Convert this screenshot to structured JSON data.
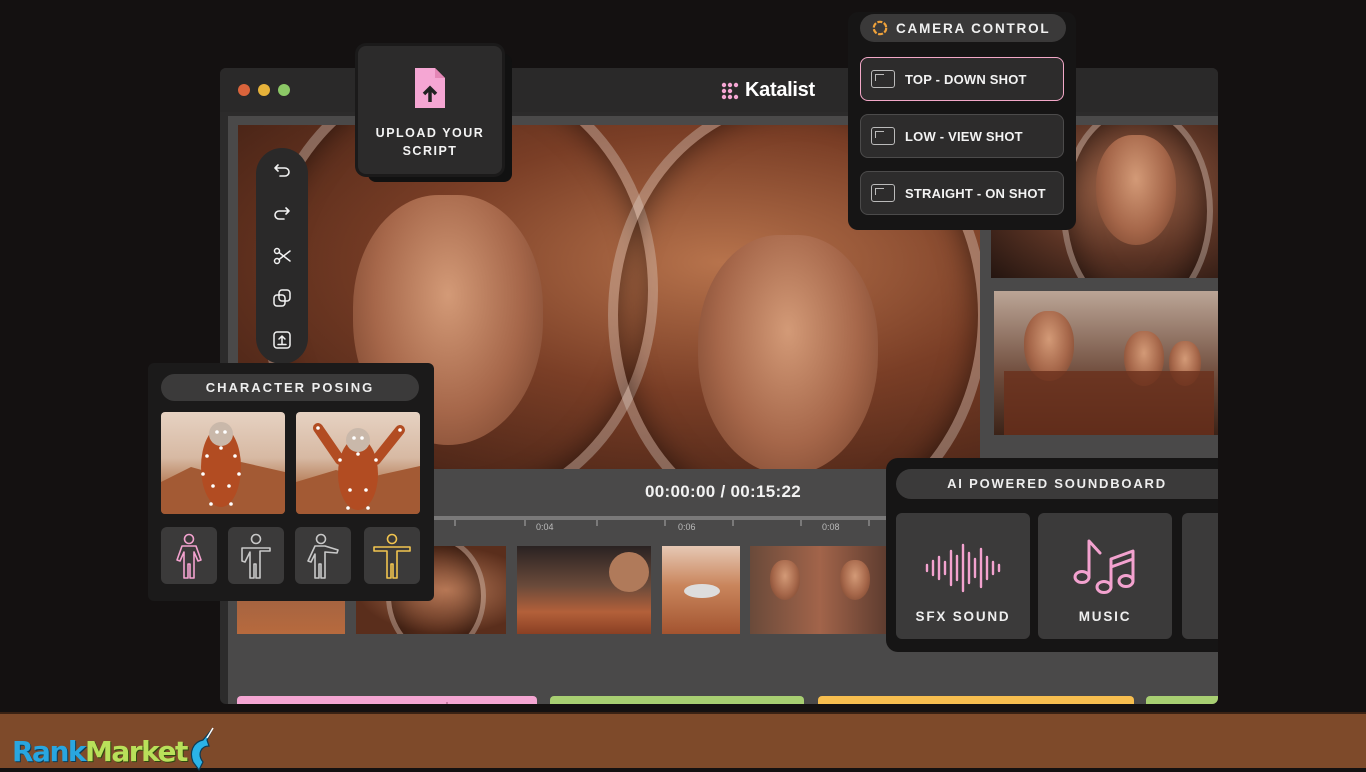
{
  "app": {
    "brand": "Katalist",
    "window_dots": [
      "#d9633b",
      "#e6b23a",
      "#8cc866"
    ]
  },
  "timeline": {
    "time_display": "00:00:00 / 00:15:22",
    "ticks": [
      "0:04",
      "0:06",
      "0:08"
    ]
  },
  "upload_card": {
    "label_line1": "UPLOAD YOUR",
    "label_line2": "SCRIPT",
    "icon": "file-upload-icon"
  },
  "toolbar": {
    "icons": [
      "undo-icon",
      "redo-icon",
      "scissors-icon",
      "duplicate-icon",
      "export-icon"
    ]
  },
  "camera_control": {
    "title": "CAMERA CONTROL",
    "shots": [
      {
        "label": "TOP - DOWN SHOT",
        "selected": true
      },
      {
        "label": "LOW - VIEW SHOT",
        "selected": false
      },
      {
        "label": "STRAIGHT - ON SHOT",
        "selected": false
      }
    ]
  },
  "character_posing": {
    "title": "CHARACTER POSING",
    "pose_buttons": [
      "pose-standing-icon",
      "pose-wave-icon",
      "pose-point-icon",
      "pose-tpose-icon"
    ],
    "pose_colors": [
      "#f3a2cf",
      "#c8c8c8",
      "#c8c8c8",
      "#f1c44f"
    ]
  },
  "soundboard": {
    "title": "AI POWERED SOUNDBOARD",
    "cards": [
      {
        "label": "SFX SOUND",
        "icon": "sound-wave-icon"
      },
      {
        "label": "MUSIC",
        "icon": "music-notes-icon"
      }
    ]
  },
  "audio_tracks": {
    "colors": [
      "#f5a6d3",
      "#a8cf72",
      "#f7be4f",
      "#a8cf72"
    ]
  },
  "footer": {
    "logo_part1": "Rank",
    "logo_part2": "Market",
    "bg": "#7e4a2a"
  }
}
